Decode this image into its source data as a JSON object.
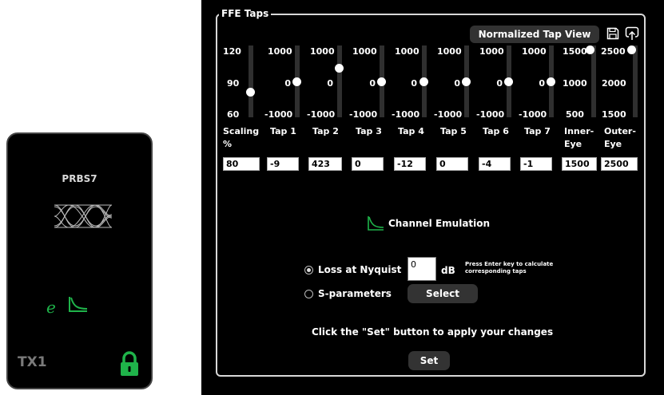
{
  "tx_card": {
    "pattern": "PRBS7",
    "name": "TX1",
    "emulation_glyph": "e",
    "accent_color": "#1fb34a",
    "icons": [
      "eye-diagram-icon",
      "channel-curve-icon",
      "lock-icon"
    ]
  },
  "ffe": {
    "title": "FFE Taps",
    "normalized_button": "Normalized Tap View",
    "icons": [
      "save-icon",
      "load-icon"
    ],
    "columns": [
      {
        "title_line1": "Scaling",
        "title_line2": "%",
        "max": "120",
        "mid": "90",
        "min": "60",
        "value": "80",
        "level": 0.33
      },
      {
        "title_line1": "Tap 1",
        "title_line2": "",
        "max": "1000",
        "mid": "0",
        "min": "-1000",
        "value": "-9",
        "level": 0.495
      },
      {
        "title_line1": "Tap 2",
        "title_line2": "",
        "max": "1000",
        "mid": "0",
        "min": "-1000",
        "value": "423",
        "level": 0.71
      },
      {
        "title_line1": "Tap 3",
        "title_line2": "",
        "max": "1000",
        "mid": "0",
        "min": "-1000",
        "value": "0",
        "level": 0.5
      },
      {
        "title_line1": "Tap 4",
        "title_line2": "",
        "max": "1000",
        "mid": "0",
        "min": "-1000",
        "value": "-12",
        "level": 0.494
      },
      {
        "title_line1": "Tap 5",
        "title_line2": "",
        "max": "1000",
        "mid": "0",
        "min": "-1000",
        "value": "0",
        "level": 0.5
      },
      {
        "title_line1": "Tap 6",
        "title_line2": "",
        "max": "1000",
        "mid": "0",
        "min": "-1000",
        "value": "-4",
        "level": 0.498
      },
      {
        "title_line1": "Tap 7",
        "title_line2": "",
        "max": "1000",
        "mid": "0",
        "min": "-1000",
        "value": "-1",
        "level": 0.4995
      },
      {
        "title_line1": "Inner-",
        "title_line2": "Eye",
        "max": "1500",
        "mid": "1000",
        "min": "500",
        "value": "1500",
        "level": 1.0
      },
      {
        "title_line1": "Outer-",
        "title_line2": "Eye",
        "max": "2500",
        "mid": "2000",
        "min": "1500",
        "value": "2500",
        "level": 1.0
      }
    ]
  },
  "channel": {
    "label": "Channel Emulation",
    "loss_label": "Loss at Nyquist",
    "loss_value": "0",
    "loss_unit": "dB",
    "hint_line1": "Press Enter key to calculate",
    "hint_line2": "corresponding taps",
    "sparam_label": "S-parameters",
    "select_button": "Select",
    "selected_option": "Loss at Nyquist"
  },
  "footer": {
    "info": "Click the \"Set\" button to apply your changes",
    "set_button": "Set"
  }
}
